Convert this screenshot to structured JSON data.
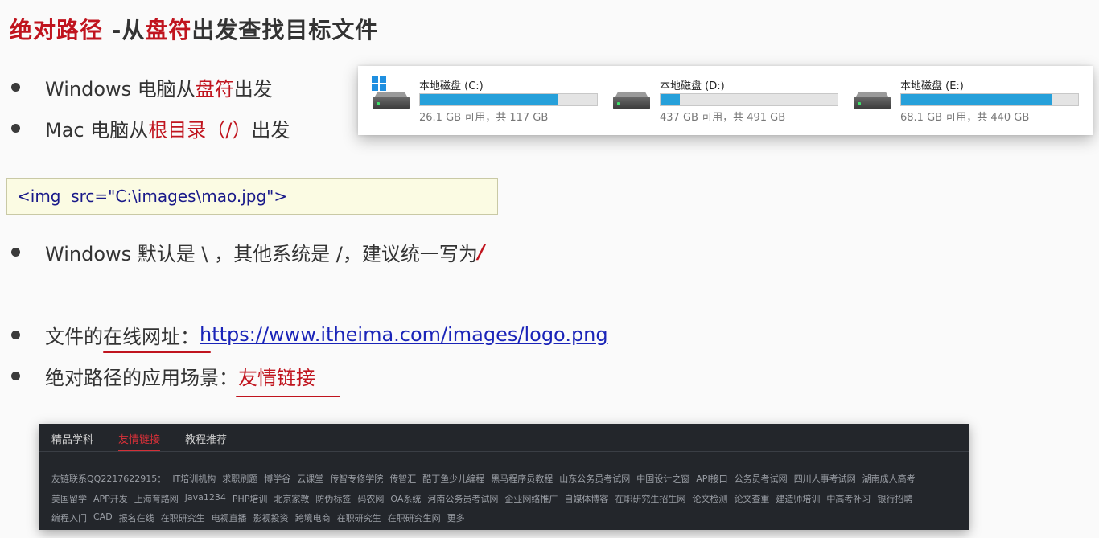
{
  "title": {
    "part1": "绝对路径",
    "part2": " -从",
    "part3": "盘符",
    "part4": "出发查找目标文件"
  },
  "bullets": {
    "windows": {
      "prefix": "Windows 电脑从",
      "highlight": "盘符",
      "suffix": "出发"
    },
    "mac": {
      "prefix": "Mac 电脑从",
      "highlight": "根目录（/）",
      "suffix": "出发"
    },
    "slash": {
      "text": "Windows 默认是 \\ ，其他系统是 /，建议统一写为 ",
      "highlight": "/"
    },
    "online": {
      "label": "文件的在线网址：",
      "url": "https://www.itheima.com/images/logo.png"
    },
    "usage": {
      "label": "绝对路径的应用场景：",
      "highlight": "友情链接"
    }
  },
  "code": "<img  src=\"C:\\images\\mao.jpg\">",
  "drives": [
    {
      "name": "本地磁盘 (C:)",
      "size": "26.1 GB 可用，共 117 GB",
      "used_fraction": 0.78
    },
    {
      "name": "本地磁盘 (D:)",
      "size": "437 GB 可用，共 491 GB",
      "used_fraction": 0.11
    },
    {
      "name": "本地磁盘 (E:)",
      "size": "68.1 GB 可用，共 440 GB",
      "used_fraction": 0.85
    }
  ],
  "footer": {
    "tabs": [
      "精品学科",
      "友情链接",
      "教程推荐"
    ],
    "active_tab": "友情链接",
    "lines": [
      [
        "友链联系QQ2217622915：",
        "IT培训机构",
        "求职刷题",
        "博学谷",
        "云课堂",
        "传智专修学院",
        "传智汇",
        "酷丁鱼少儿编程",
        "黑马程序员教程",
        "山东公务员考试网",
        "中国设计之窗",
        "API接口",
        "公务员考试网",
        "四川人事考试网",
        "湖南成人高考"
      ],
      [
        "美国留学",
        "APP开发",
        "上海育路网",
        "java1234",
        "PHP培训",
        "北京家教",
        "防伪标签",
        "码农网",
        "OA系统",
        "河南公务员考试网",
        "企业网络推广",
        "自媒体博客",
        "在职研究生招生网",
        "论文检测",
        "论文查重",
        "建造师培训",
        "中高考补习",
        "银行招聘"
      ],
      [
        "编程入门",
        "CAD",
        "报名在线",
        "在职研究生",
        "电视直播",
        "影视投资",
        "跨境电商",
        "在职研究生",
        "在职研究生网",
        "更多"
      ]
    ]
  },
  "colors": {
    "accent_red": "#c0141e",
    "link_blue": "#1a24b8",
    "bar_blue": "#26a0da",
    "footer_bg": "#23262b"
  }
}
